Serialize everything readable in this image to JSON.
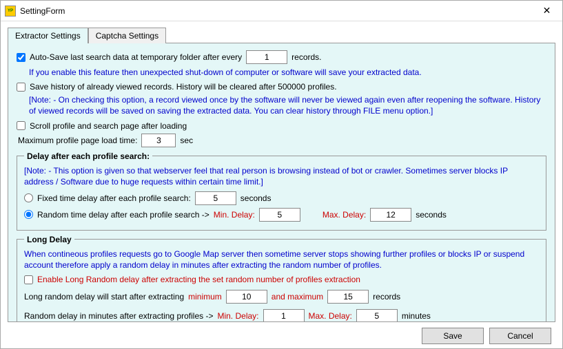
{
  "window": {
    "title": "SettingForm",
    "icon_text": "YP"
  },
  "tabs": {
    "extractor": "Extractor Settings",
    "captcha": "Captcha Settings"
  },
  "autosave": {
    "label_before": "Auto-Save last search data at temporary folder after every",
    "value": "1",
    "label_after": "records.",
    "note": "If you enable this feature then unexpected shut-down of computer or software will save your extracted data."
  },
  "history": {
    "label": "Save history of already viewed records. History will be cleared after 500000 profiles.",
    "note": "[Note: - On checking this option, a record viewed once by the software will never be viewed again even after reopening the software. History of viewed records will be saved on saving the extracted data. You can clear history through FILE menu option.]"
  },
  "scroll": {
    "label": "Scroll profile and search page after loading"
  },
  "maxload": {
    "label_before": "Maximum profile page load time:",
    "value": "3",
    "label_after": "sec"
  },
  "delay": {
    "legend": "Delay after each profile search:",
    "note": "[Note: - This option is given so that webserver feel that real person is browsing instead of bot or crawler. Sometimes server blocks IP address / Software due to huge requests within certain time limit.]",
    "fixed": {
      "label_before": "Fixed time delay after each profile search:",
      "value": "5",
      "label_after": "seconds"
    },
    "random": {
      "label_before": "Random time delay after each profile search ->",
      "min_label": "Min. Delay:",
      "min_value": "5",
      "max_label": "Max. Delay:",
      "max_value": "12",
      "label_after": "seconds"
    }
  },
  "longdelay": {
    "legend": "Long Delay",
    "desc": "When contineous profiles requests go to Google Map server then sometime server stops showing further profiles or blocks IP or suspend account therefore apply a random delay in minutes after extracting the random number of profiles.",
    "enable_label": "Enable Long Random delay after extracting the set  random number of profiles extraction",
    "start": {
      "before": "Long random delay will start after extracting",
      "min_label": "minimum",
      "min_value": "10",
      "mid": "and maximum",
      "max_value": "15",
      "after": "records"
    },
    "rand": {
      "before": "Random delay in minutes after extracting profiles ->",
      "min_label": "Min. Delay:",
      "min_value": "1",
      "max_label": "Max. Delay:",
      "max_value": "5",
      "after": "minutes"
    }
  },
  "buttons": {
    "save": "Save",
    "cancel": "Cancel"
  }
}
